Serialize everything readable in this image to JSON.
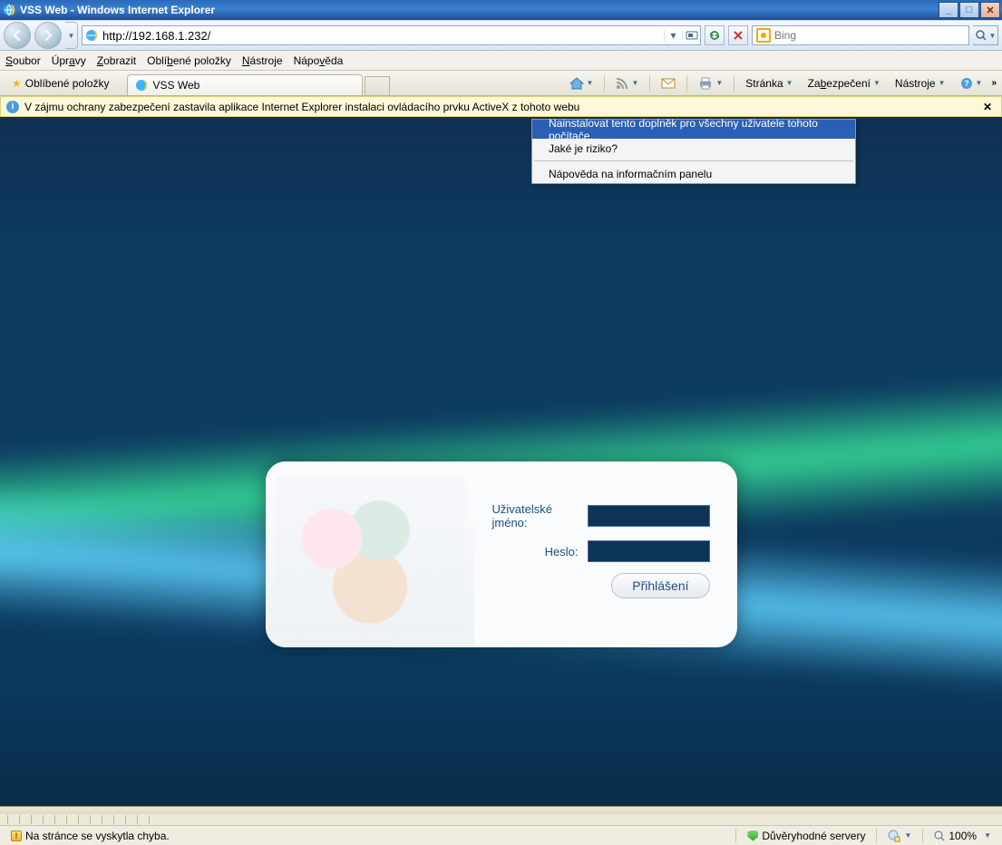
{
  "titlebar": {
    "title": "VSS Web - Windows Internet Explorer"
  },
  "address": {
    "url": "http://192.168.1.232/"
  },
  "search": {
    "engine": "Bing",
    "placeholder": "Bing"
  },
  "menubar": {
    "soubor": "Soubor",
    "upravy": "Úpravy",
    "zobrazit": "Zobrazit",
    "oblibene": "Oblíbené položky",
    "nastroje": "Nástroje",
    "napoveda": "Nápověda"
  },
  "favbar": {
    "oblibene_btn": "Oblíbené položky",
    "tab_title": "VSS Web"
  },
  "cmdbar": {
    "stranka": "Stránka",
    "zabezpeceni": "Zabezpečení",
    "nastroje": "Nástroje"
  },
  "infobar": {
    "text": "V zájmu ochrany zabezpečení zastavila aplikace Internet Explorer instalaci ovládacího prvku ActiveX z tohoto webu"
  },
  "ctx": {
    "install": "Nainstalovat tento doplněk pro všechny uživatele tohoto počítače…",
    "risk": "Jaké je riziko?",
    "help": "Nápověda na informačním panelu"
  },
  "login": {
    "user_label": "Uživatelské jméno:",
    "pass_label": "Heslo:",
    "submit": "Přihlášení",
    "username": "",
    "password": ""
  },
  "status": {
    "error": "Na stránce se vyskytla chyba.",
    "zone": "Důvěryhodné servery",
    "zoom": "100%"
  },
  "colors": {
    "page_bg": "#0d3b60",
    "accent": "#2b5fb4"
  }
}
